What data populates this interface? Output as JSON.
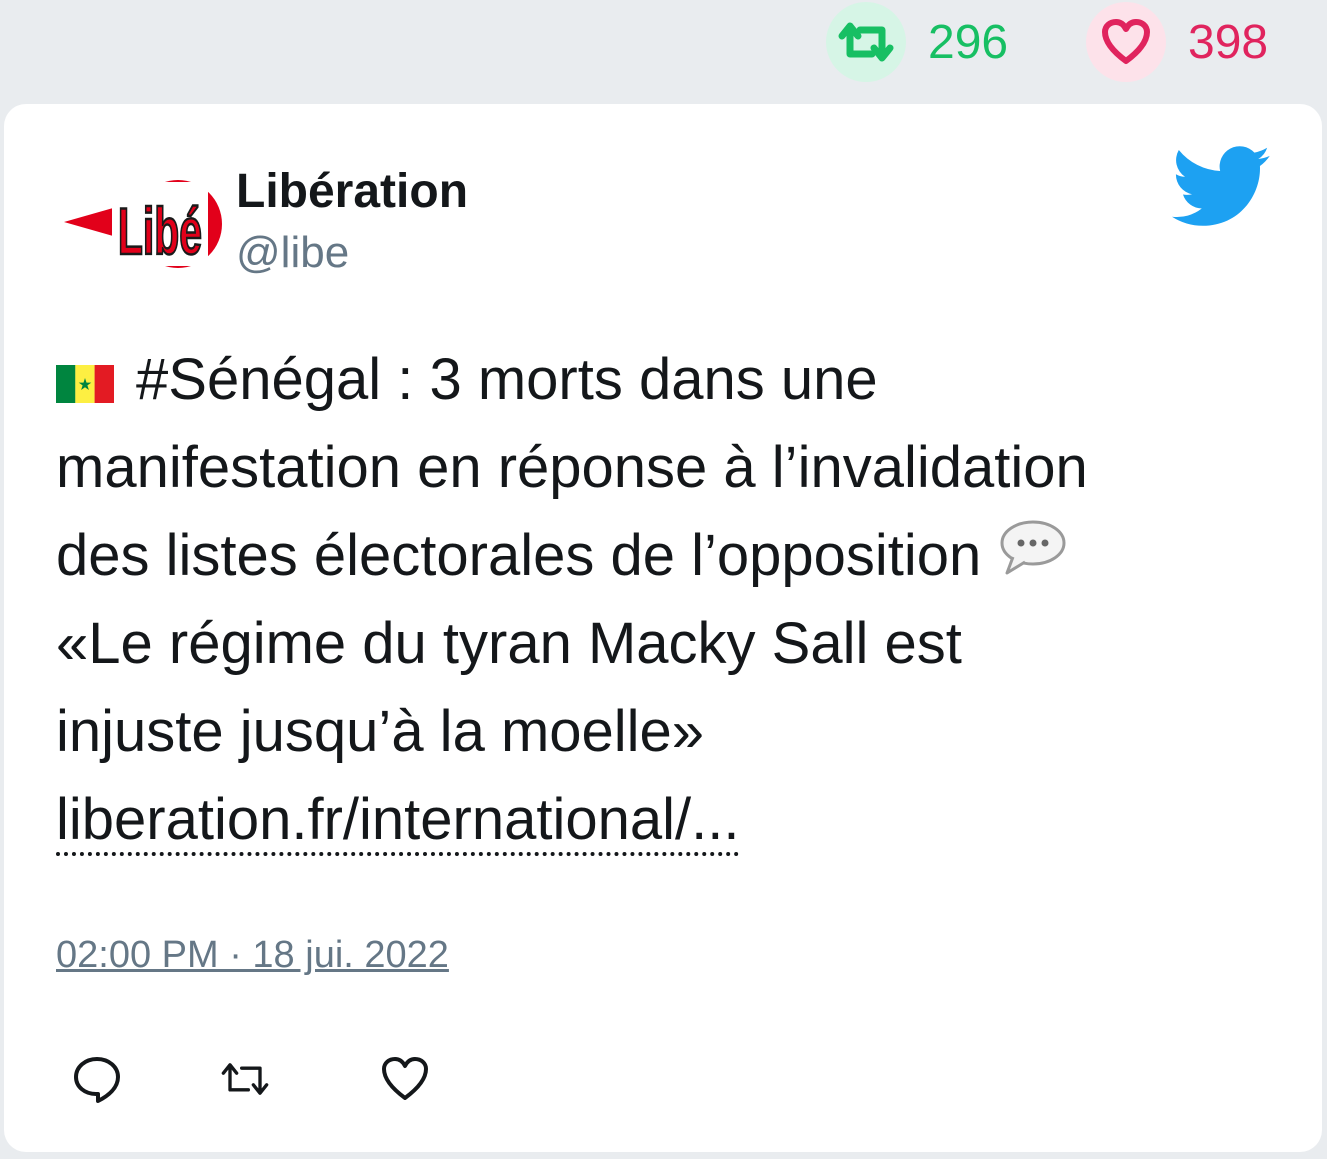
{
  "stats": {
    "retweets": "296",
    "likes": "398",
    "retweet_color": "#17bf63",
    "like_color": "#e0245e",
    "retweet_icon": "retweet-icon",
    "like_icon": "heart-icon"
  },
  "tweet": {
    "author_name": "Libération",
    "author_handle": "@libe",
    "avatar_text": "Libé",
    "lines": [
      "#Sénégal : 3 morts dans une",
      "manifestation en réponse à l’invalidation",
      "des listes électorales de l’opposition",
      "«Le régime du tyran Macky Sall est",
      "injuste jusqu’à la moelle»"
    ],
    "link": "liberation.fr/international/...",
    "timestamp": "02:00 PM · 18 jui. 2022"
  },
  "icons": {
    "brand": "twitter-bird-icon",
    "flag": "senegal-flag-icon",
    "speech": "speech-bubble-icon",
    "actions": [
      "reply-icon",
      "retweet-icon",
      "heart-icon"
    ]
  },
  "colors": {
    "twitter_blue": "#1da1f2",
    "secondary_text": "#657786",
    "libe_red": "#e2001a"
  }
}
